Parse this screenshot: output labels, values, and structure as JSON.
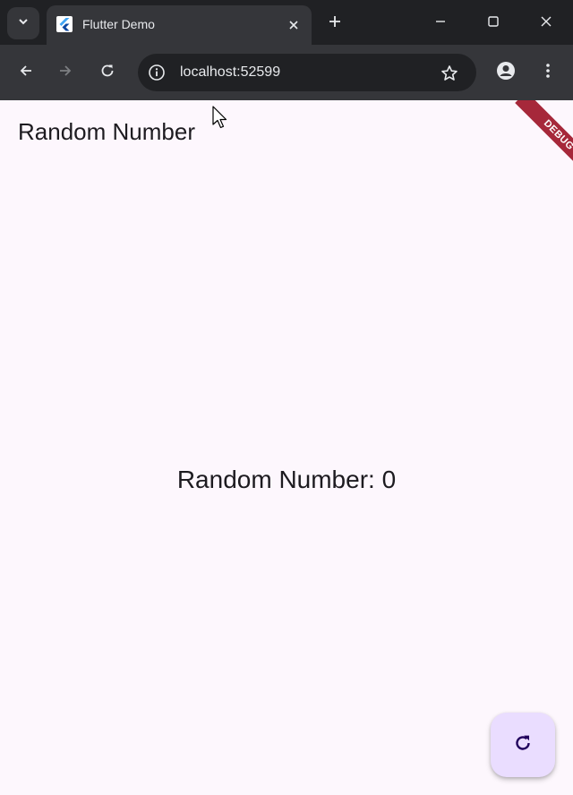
{
  "browser": {
    "tab_title": "Flutter Demo",
    "url": "localhost:52599",
    "colors": {
      "tabstrip": "#202124",
      "toolbar": "#35363a",
      "text": "#e8eaed"
    }
  },
  "app": {
    "appbar_title": "Random Number",
    "body_text": "Random Number: 0",
    "debug_label": "DEBUG",
    "fab_icon": "refresh-icon",
    "colors": {
      "background": "#fdf7fd",
      "fab": "#eaddff",
      "fab_icon": "#21005d",
      "debug": "#a6283a"
    }
  }
}
